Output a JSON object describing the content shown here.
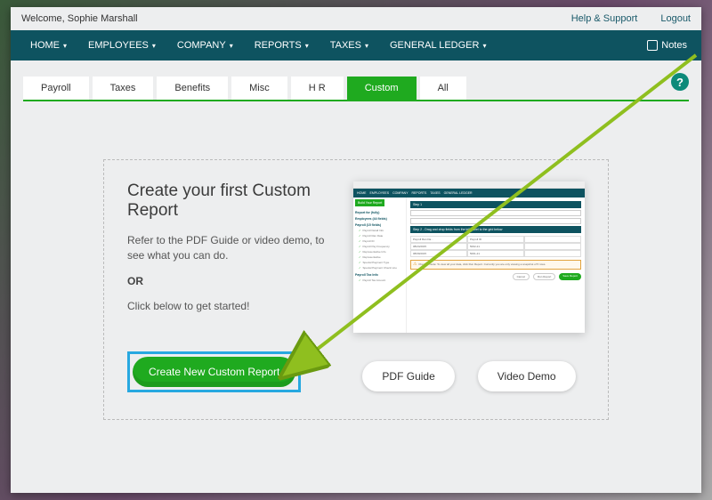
{
  "topbar": {
    "welcome": "Welcome, Sophie Marshall",
    "help": "Help & Support",
    "logout": "Logout"
  },
  "nav": {
    "items": [
      "HOME",
      "EMPLOYEES",
      "COMPANY",
      "REPORTS",
      "TAXES",
      "GENERAL LEDGER"
    ],
    "notes": "Notes"
  },
  "tabs": {
    "items": [
      "Payroll",
      "Taxes",
      "Benefits",
      "Misc",
      "H R",
      "Custom",
      "All"
    ],
    "active_index": 5
  },
  "panel": {
    "heading": "Create your first Custom Report",
    "p1": "Refer to the PDF Guide or video demo, to see what you can do.",
    "or": "OR",
    "p2": "Click below to get started!",
    "create_btn": "Create New Custom Report",
    "pdf_btn": "PDF Guide",
    "video_btn": "Video Demo"
  },
  "help_icon": "?",
  "accent_green": "#1faa1f",
  "accent_teal": "#0e5360",
  "highlight_blue": "#27a8e0"
}
